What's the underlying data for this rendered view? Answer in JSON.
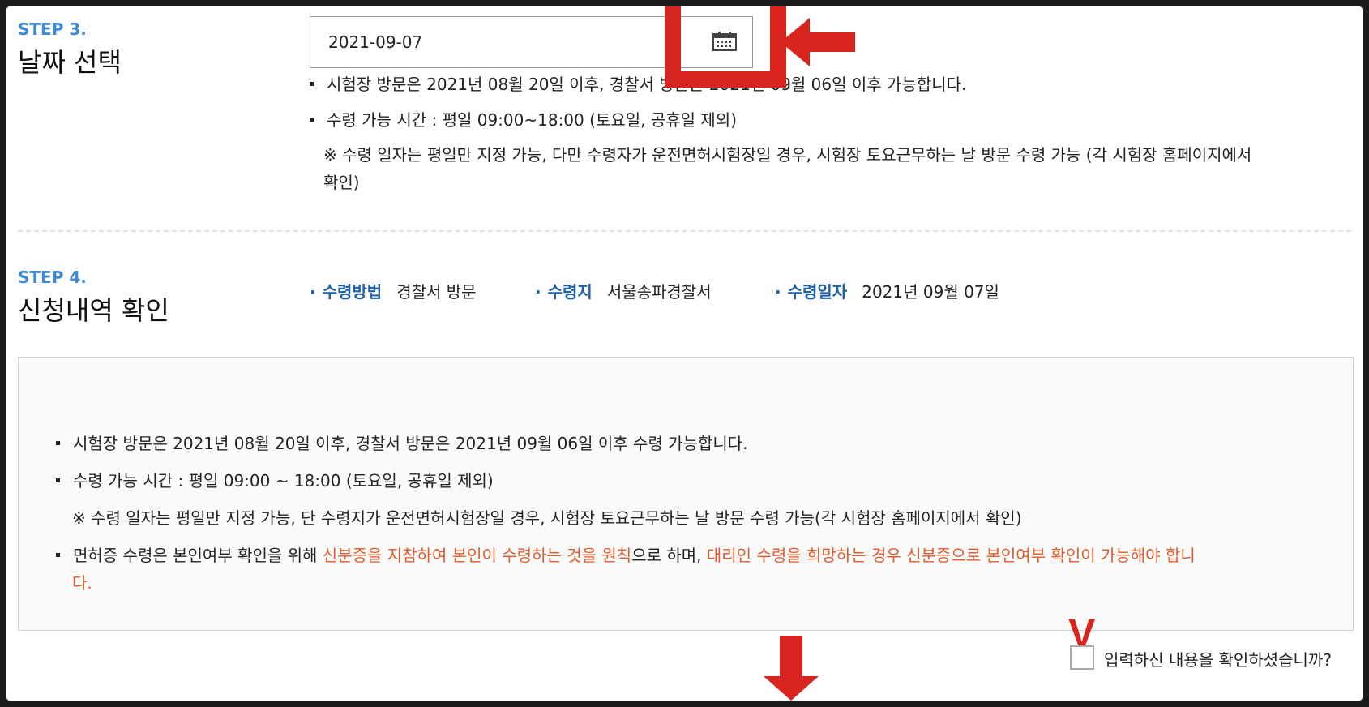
{
  "step3": {
    "label": "STEP 3.",
    "title": "날짜 선택",
    "date_value": "2021-09-07",
    "bullets": [
      "시험장 방문은 2021년 08월 20일 이후, 경찰서 방문은 2021년 09월 06일 이후 가능합니다.",
      "수령 가능 시간 : 평일 09:00~18:00 (토요일, 공휴일 제외)"
    ],
    "note_line1": "※ 수령 일자는 평일만 지정 가능, 다만 수령자가 운전면허시험장일 경우, 시험장 토요근무하는 날 방문 수령 가능 (각 시험장 홈페이지에서",
    "note_line2": "확인)"
  },
  "step4": {
    "label": "STEP 4.",
    "title": "신청내역 확인",
    "summary": [
      {
        "label": "수령방법",
        "value": "경찰서 방문"
      },
      {
        "label": "수령지",
        "value": "서울송파경찰서"
      },
      {
        "label": "수령일자",
        "value": "2021년 09월 07일"
      }
    ]
  },
  "notice": {
    "bullet1": "시험장 방문은 2021년 08월 20일 이후, 경찰서 방문은 2021년 09월 06일 이후 수령 가능합니다.",
    "bullet2": "수령 가능 시간 : 평일 09:00 ~ 18:00 (토요일, 공휴일 제외)",
    "note": "※ 수령 일자는 평일만 지정 가능, 단 수령지가 운전면허시험장일 경우, 시험장 토요근무하는 날 방문 수령 가능(각 시험장 홈페이지에서 확인)",
    "bullet3_a": "면허증 수령은 본인여부 확인을 위해 ",
    "bullet3_red1": "신분증을 지참하여 본인이 수령하는 것을 원칙",
    "bullet3_b": "으로 하며, ",
    "bullet3_red2": "대리인 수령을 희망하는 경우 신분증으로 본인여부 확인이 가능해야 합니",
    "bullet3_red3": "다."
  },
  "confirm": {
    "question": "입력하신 내용을 확인하셨습니까?",
    "checked": false
  },
  "annotation": {
    "v_mark": "V"
  },
  "colors": {
    "step_label": "#3f8ad8",
    "summary_label": "#1f5fa8",
    "emphasis_red": "#e05a2a",
    "annotation_red": "#d8241e"
  },
  "icons": {
    "calendar": "calendar-icon"
  }
}
